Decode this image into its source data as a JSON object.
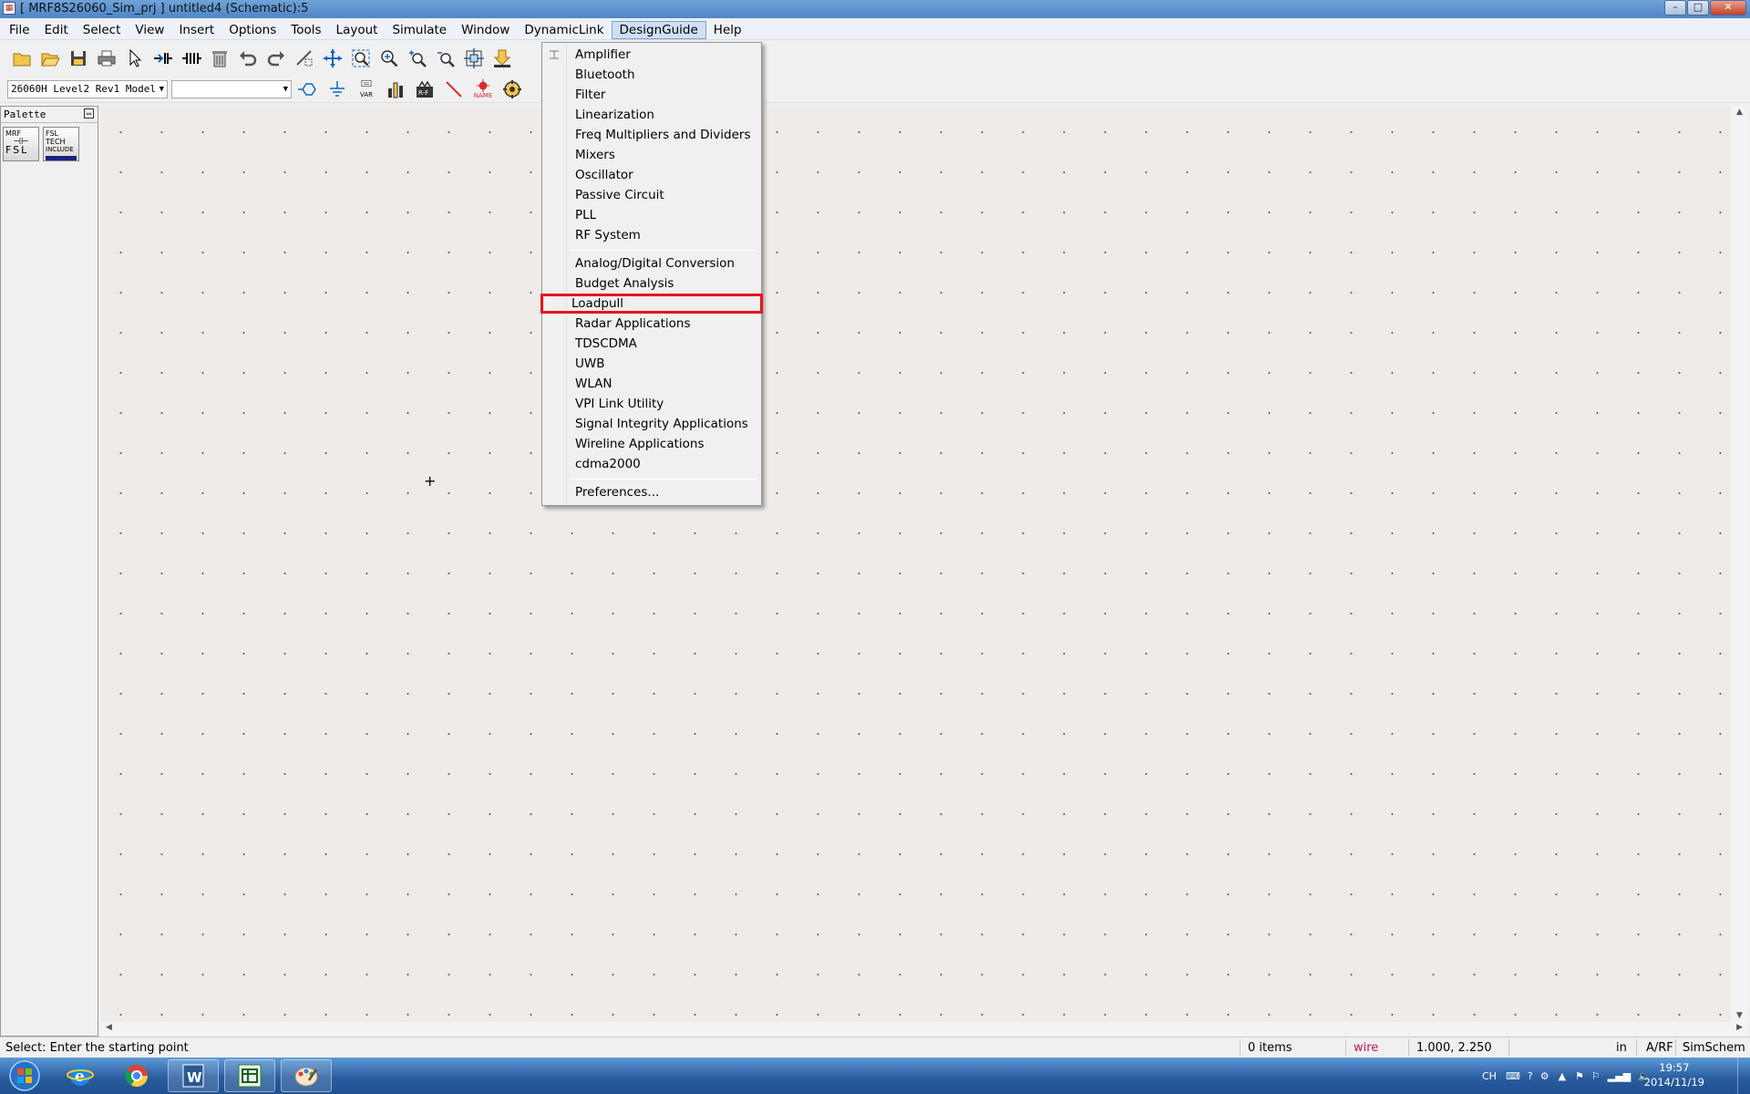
{
  "window": {
    "title": "[ MRF8S26060_Sim_prj ] untitled4 (Schematic):5",
    "app_icon_text": "▦",
    "controls": {
      "minimize": "–",
      "maximize": "□",
      "close": "✕"
    }
  },
  "menubar": {
    "items": [
      "File",
      "Edit",
      "Select",
      "View",
      "Insert",
      "Options",
      "Tools",
      "Layout",
      "Simulate",
      "Window",
      "DynamicLink",
      "DesignGuide",
      "Help"
    ],
    "open_item": "DesignGuide"
  },
  "toolbar": {
    "icons": [
      "new-folder-icon",
      "open-folder-icon",
      "save-icon",
      "print-icon",
      "select-arrow-icon",
      "insert-port-icon",
      "insert-component-icon",
      "delete-icon",
      "undo-icon",
      "redo-icon",
      "mirror-icon",
      "move-icon",
      "zoom-area-icon",
      "zoom-in-icon",
      "zoom-in-2-icon",
      "zoom-out-icon",
      "fit-view-icon",
      "download-icon"
    ]
  },
  "toolbar2": {
    "library_combo_value": "26060H Level2 Rev1 Model",
    "component_combo_value": "",
    "icons": [
      "port-icon",
      "ground-icon",
      "var-icon",
      "display-template-icon",
      "simulate-icon",
      "wire-icon",
      "name-icon",
      "tune-icon"
    ],
    "var_label": "VAR",
    "name_label": "NAME"
  },
  "palette": {
    "title": "Palette",
    "items": [
      {
        "line1": "MRF",
        "line2": "FSL"
      },
      {
        "line1": "FSL",
        "line2": "TECH",
        "line3": "INCLUDE"
      }
    ]
  },
  "designguide_menu": {
    "group1": [
      "Amplifier",
      "Bluetooth",
      "Filter",
      "Linearization",
      "Freq Multipliers and Dividers",
      "Mixers",
      "Oscillator",
      "Passive Circuit",
      "PLL",
      "RF System"
    ],
    "group2": [
      "Analog/Digital Conversion",
      "Budget Analysis",
      "Loadpull",
      "Radar Applications",
      "TDSCDMA",
      "UWB",
      "WLAN",
      "VPI Link Utility",
      "Signal Integrity Applications",
      "Wireline Applications",
      "cdma2000"
    ],
    "group3": [
      "Preferences..."
    ],
    "highlighted": "Loadpull",
    "highlight_color": "#e8141e"
  },
  "statusbar": {
    "message": "Select: Enter the starting point",
    "items_count": "0 items",
    "mode": "wire",
    "mode_color": "#c2185b",
    "coords": "1.000, 2.250",
    "units": "in",
    "domain": "A/RF",
    "schematic_type": "SimSchem"
  },
  "taskbar": {
    "apps": [
      "start-orb-icon",
      "internet-explorer-icon",
      "chrome-icon",
      "word-icon",
      "ads-app-icon",
      "paint-icon"
    ],
    "tray_lang": "CH",
    "clock_time": "19:57",
    "clock_date": "2014/11/19"
  }
}
